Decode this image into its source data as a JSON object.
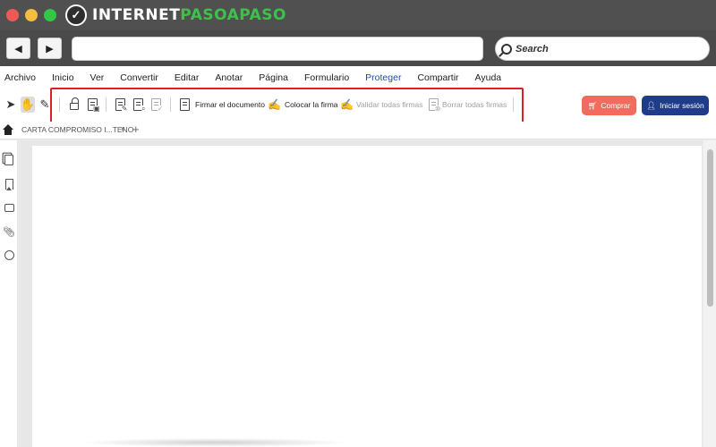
{
  "titlebar": {
    "logo_prefix": "INTERNET",
    "logo_accent": "PASOAPASO",
    "colors": {
      "close": "#ed5a55",
      "minimize": "#f3be3e",
      "maximize": "#33c748"
    }
  },
  "navbar": {
    "back_icon": "back-arrow-icon",
    "forward_icon": "forward-arrow-icon",
    "url_value": "",
    "search_placeholder": "Search"
  },
  "menu": {
    "items": [
      "Archivo",
      "Inicio",
      "Ver",
      "Convertir",
      "Editar",
      "Anotar",
      "Página",
      "Formulario",
      "Proteger",
      "Compartir",
      "Ayuda"
    ],
    "active": "Proteger",
    "active_color": "#1f4ea8"
  },
  "toolbar": {
    "sign_document": "Firmar el documento",
    "place_signature": "Colocar la firma",
    "validate_all": "Validar todas firmas",
    "delete_all": "Borrar todas firmas",
    "buy_label": "Comprar",
    "login_label": "Iniciar sesión",
    "buy_color": "#f16b5e",
    "login_color": "#1f3c8a",
    "highlight_color": "#e01e25"
  },
  "tabs": {
    "document_tab": "CARTA COMPROMISO I...TENO",
    "close_glyph": "×",
    "add_glyph": "+"
  }
}
